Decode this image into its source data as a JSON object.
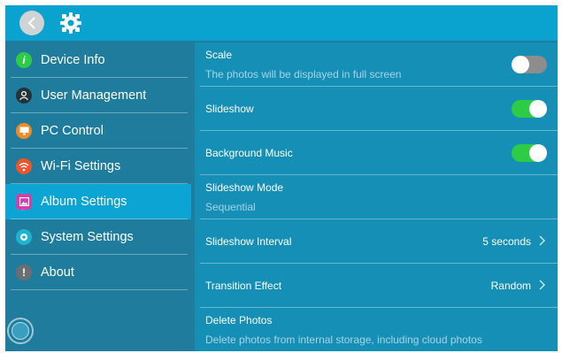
{
  "topbar": {
    "back_icon": "chevron-left-icon",
    "settings_icon": "gear-icon",
    "accent": "#0aa2cf"
  },
  "sidebar": {
    "items": [
      {
        "label": "Device Info",
        "icon": "info-icon",
        "color": "#2ecc46",
        "active": false
      },
      {
        "label": "User Management",
        "icon": "user-icon",
        "color": "#26323a",
        "active": false
      },
      {
        "label": "PC Control",
        "icon": "monitor-icon",
        "color": "#f08a24",
        "active": false
      },
      {
        "label": "Wi-Fi Settings",
        "icon": "wifi-icon",
        "color": "#f0542b",
        "active": false
      },
      {
        "label": "Album Settings",
        "icon": "image-icon",
        "color": "#d43fae",
        "active": true
      },
      {
        "label": "System Settings",
        "icon": "settings-icon",
        "color": "#20b3cf",
        "active": false
      },
      {
        "label": "About",
        "icon": "exclamation-icon",
        "color": "#6b6f73",
        "active": false
      }
    ],
    "home_icon": "home-circle-icon"
  },
  "settings": {
    "scale": {
      "title": "Scale",
      "subtitle": "The photos will be displayed in full screen",
      "enabled": false
    },
    "slideshow": {
      "title": "Slideshow",
      "enabled": true
    },
    "background_music": {
      "title": "Background Music",
      "enabled": true
    },
    "slideshow_mode": {
      "title": "Slideshow Mode",
      "subtitle": "Sequential"
    },
    "slideshow_interval": {
      "title": "Slideshow Interval",
      "value": "5 seconds"
    },
    "transition_effect": {
      "title": "Transition Effect",
      "value": "Random"
    },
    "delete_photos": {
      "title": "Delete Photos",
      "subtitle": "Delete photos from internal storage, including cloud photos"
    }
  },
  "colors": {
    "toggle_on": "#2ecc46",
    "toggle_off": "#8d8d8d",
    "active_item": "#0ba4d3"
  }
}
